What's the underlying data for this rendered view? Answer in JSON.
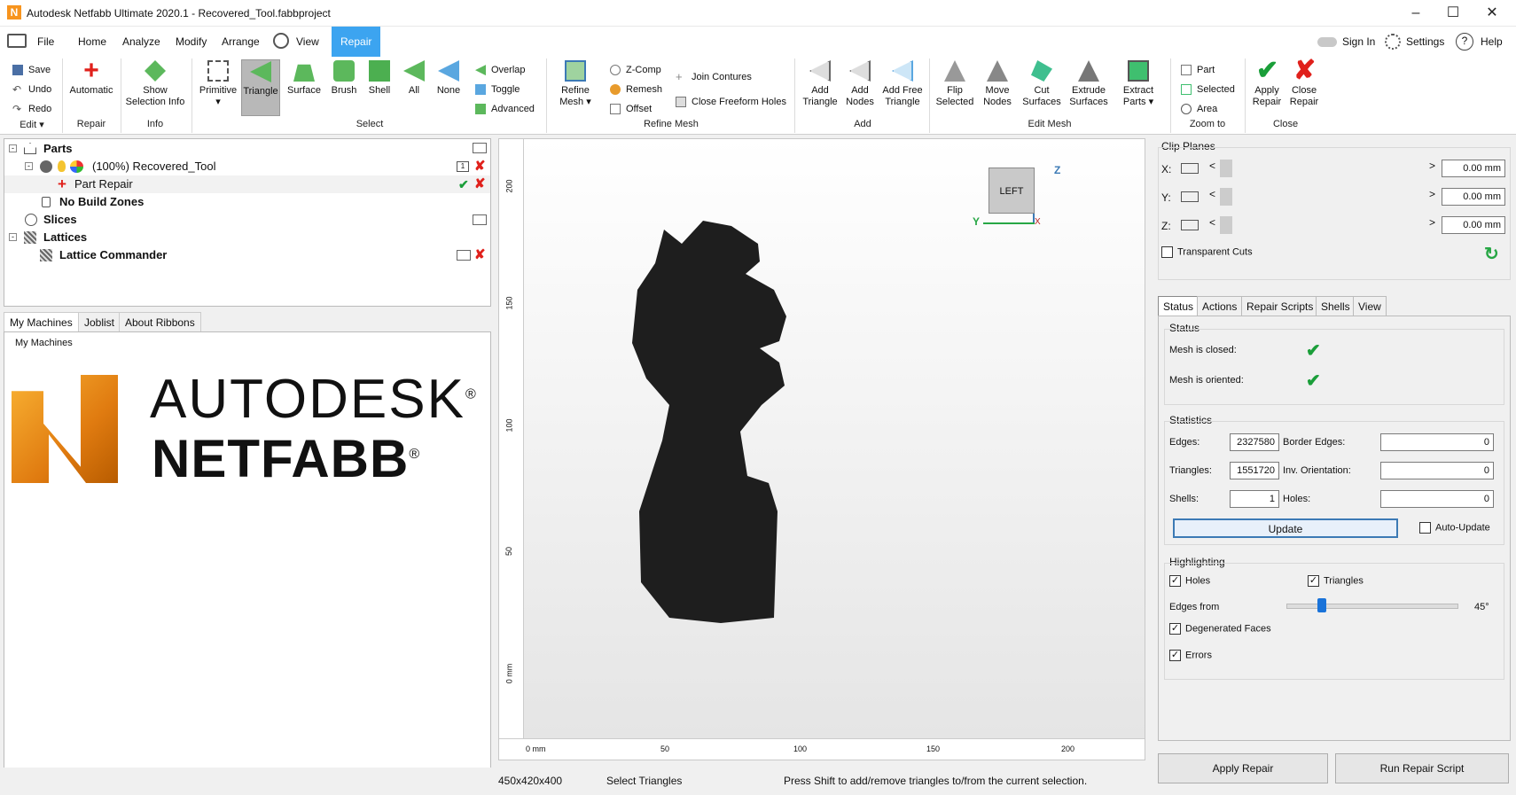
{
  "window": {
    "title": "Autodesk Netfabb Ultimate 2020.1 - Recovered_Tool.fabbproject",
    "logo_letter": "N"
  },
  "menubar": {
    "items": [
      "File",
      "Home",
      "Analyze",
      "Modify",
      "Arrange",
      "View",
      "Repair"
    ],
    "active": "Repair",
    "sign_in": "Sign In",
    "settings": "Settings",
    "help": "Help"
  },
  "ribbon": {
    "edit": {
      "save": "Save",
      "undo": "Undo",
      "redo": "Redo",
      "group": "Edit"
    },
    "repair": {
      "automatic": "Automatic",
      "group": "Repair"
    },
    "info": {
      "show_selection_info": "Show Selection Info",
      "group": "Info"
    },
    "select": {
      "primitive": "Primitive",
      "triangle": "Triangle",
      "surface": "Surface",
      "brush": "Brush",
      "shell": "Shell",
      "all": "All",
      "none": "None",
      "overlap": "Overlap",
      "toggle": "Toggle",
      "advanced": "Advanced",
      "group": "Select"
    },
    "refine": {
      "refine_mesh": "Refine Mesh",
      "zcomp": "Z-Comp",
      "remesh": "Remesh",
      "offset": "Offset",
      "join_contures": "Join Contures",
      "close_freeform_holes": "Close Freeform Holes",
      "group": "Refine Mesh"
    },
    "add": {
      "add_triangle": "Add Triangle",
      "add_nodes": "Add Nodes",
      "add_free_triangle": "Add Free Triangle",
      "group": "Add"
    },
    "edit_mesh": {
      "flip_selected": "Flip Selected",
      "move_nodes": "Move Nodes",
      "cut_surfaces": "Cut Surfaces",
      "extrude_surfaces": "Extrude Surfaces",
      "extract_parts": "Extract Parts",
      "group": "Edit Mesh"
    },
    "zoom": {
      "part": "Part",
      "selected": "Selected",
      "area": "Area",
      "group": "Zoom to"
    },
    "close": {
      "apply_repair": "Apply Repair",
      "close_repair": "Close Repair",
      "group": "Close"
    }
  },
  "tree": {
    "parts": "Parts",
    "recovered_tool": "(100%) Recovered_Tool",
    "part_repair": "Part Repair",
    "no_build_zones": "No Build Zones",
    "slices": "Slices",
    "lattices": "Lattices",
    "lattice_commander": "Lattice Commander",
    "layer_count": "1"
  },
  "left_tabs": {
    "items": [
      "My Machines",
      "Joblist",
      "About Ribbons"
    ],
    "active": "My Machines",
    "group_title": "My Machines"
  },
  "brand": {
    "line1": "AUTODESK",
    "line2": "NETFABB",
    "reg": "®"
  },
  "viewport": {
    "cube_label": "LEFT",
    "axis_z": "Z",
    "axis_y": "Y",
    "axis_x": "X",
    "x_ticks": [
      "0 mm",
      "50",
      "100",
      "150",
      "200"
    ],
    "y_ticks": [
      "200",
      "150",
      "100",
      "50",
      "0 mm"
    ]
  },
  "clip_planes": {
    "title": "Clip Planes",
    "x_label": "X:",
    "y_label": "Y:",
    "z_label": "Z:",
    "x_value": "0.00 mm",
    "y_value": "0.00 mm",
    "z_value": "0.00 mm",
    "transparent_cuts": "Transparent Cuts"
  },
  "right_tabs": {
    "items": [
      "Status",
      "Actions",
      "Repair Scripts",
      "Shells",
      "View"
    ],
    "active": "Status"
  },
  "status": {
    "title": "Status",
    "mesh_closed": "Mesh is closed:",
    "mesh_oriented": "Mesh is oriented:",
    "stats_title": "Statistics",
    "edges_label": "Edges:",
    "edges": "2327580",
    "border_edges_label": "Border Edges:",
    "border_edges": "0",
    "triangles_label": "Triangles:",
    "triangles": "1551720",
    "inv_orientation_label": "Inv. Orientation:",
    "inv_orientation": "0",
    "shells_label": "Shells:",
    "shells": "1",
    "holes_label": "Holes:",
    "holes": "0",
    "update": "Update",
    "auto_update": "Auto-Update",
    "highlight_title": "Highlighting",
    "holes_cb": "Holes",
    "triangles_cb": "Triangles",
    "edges_from": "Edges from",
    "edges_angle": "45°",
    "edges_angle_fraction": 0.18,
    "degenerated_faces": "Degenerated Faces",
    "errors": "Errors"
  },
  "bottom_buttons": {
    "apply_repair": "Apply Repair",
    "run_repair_script": "Run Repair Script"
  },
  "statusbar": {
    "dimensions": "450x420x400",
    "mode": "Select Triangles",
    "hint": "Press Shift to add/remove triangles to/from the current selection."
  },
  "colors": {
    "accent": "#3ca4f0",
    "model": "#1e1e1e",
    "check_green": "#1a9e39",
    "red_x": "#e0201b"
  }
}
